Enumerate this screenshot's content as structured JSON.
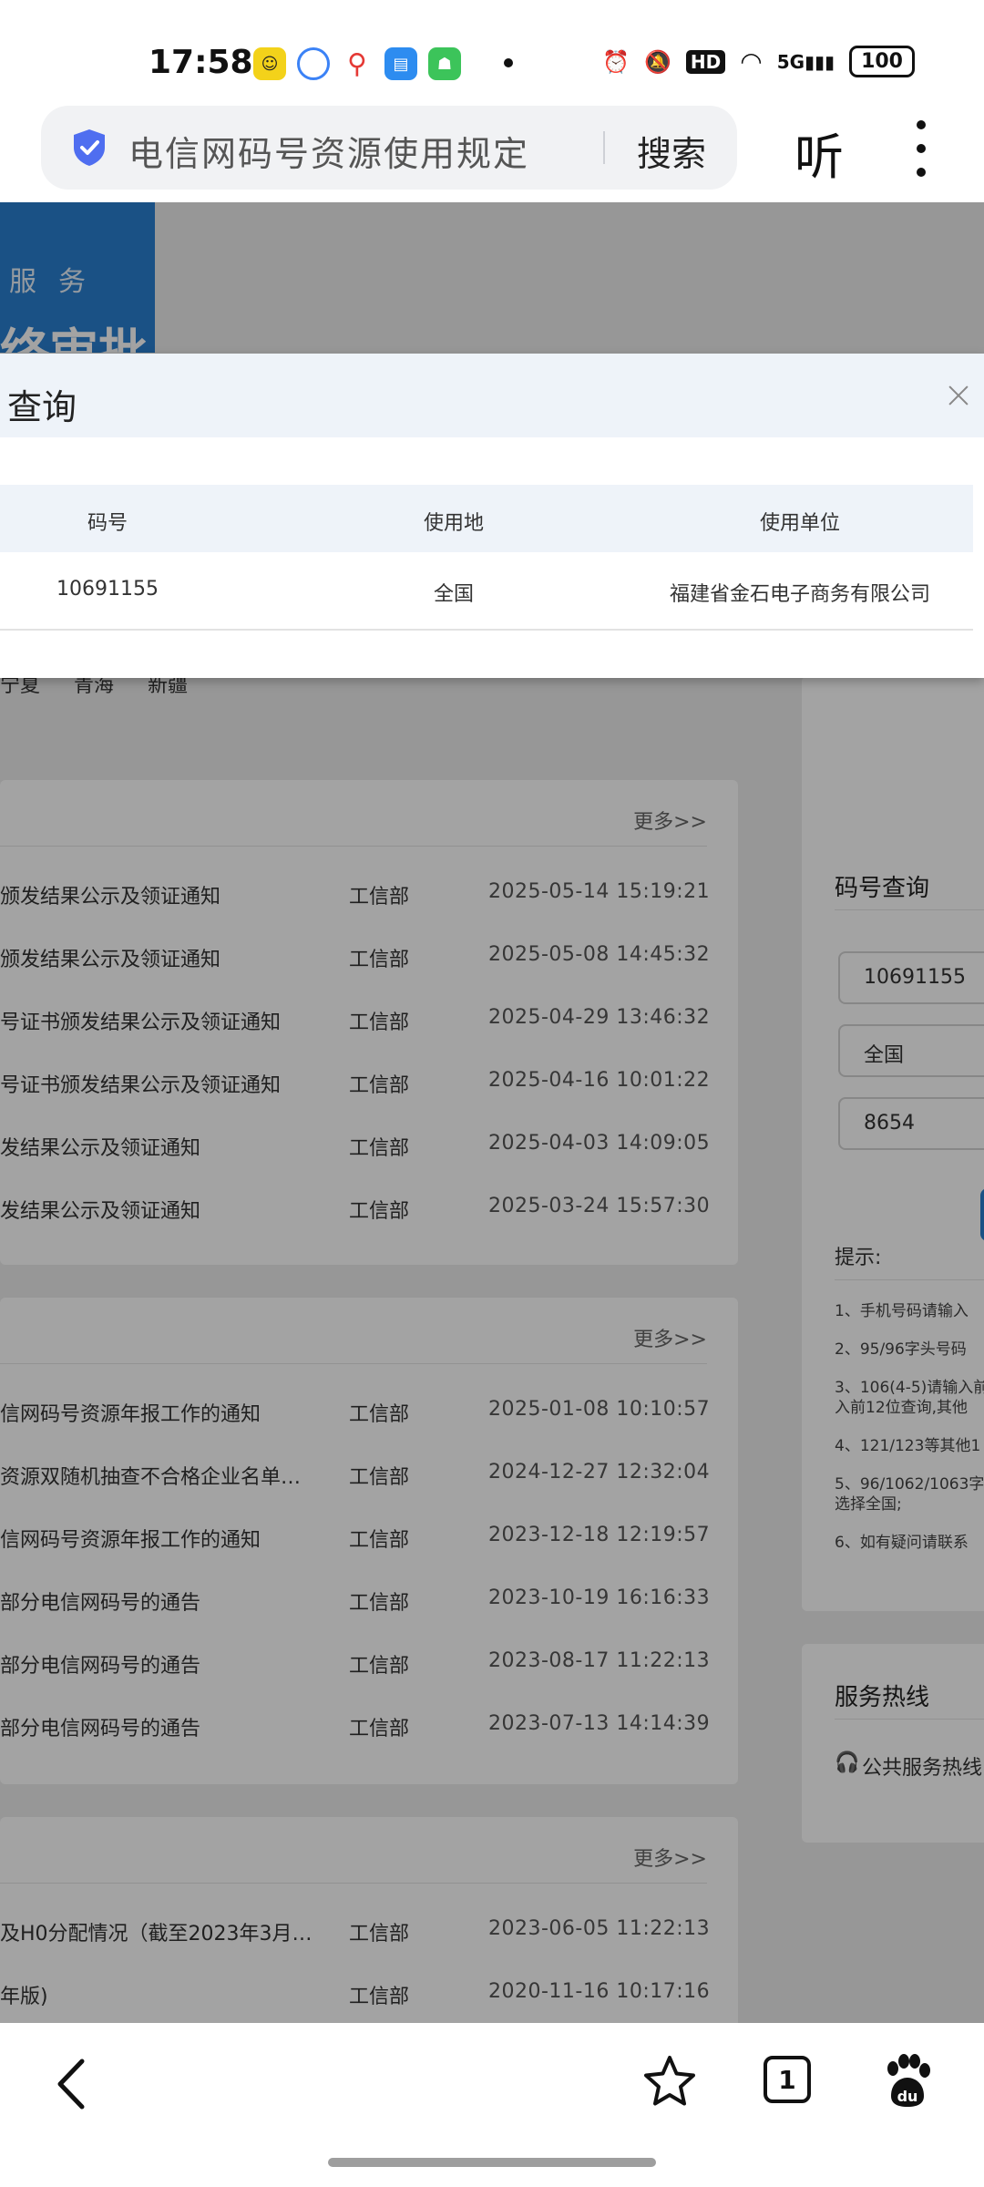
{
  "status_bar": {
    "time": "17:58",
    "hd_label": "HD",
    "network_label": "5G",
    "battery": "100"
  },
  "browser": {
    "address_text": "电信网码号资源使用规定",
    "search_label": "搜索",
    "listen_label": "听"
  },
  "banner": {
    "line1": "服务",
    "line2": "终审批"
  },
  "modal": {
    "title": "查询",
    "columns": [
      "码号",
      "使用地",
      "使用单位"
    ],
    "rows": [
      {
        "number": "10691155",
        "region": "全国",
        "unit": "福建省金石电子商务有限公司"
      }
    ]
  },
  "regions_strip": "宁夏 青海 新疆",
  "news_sections": [
    {
      "more_label": "更多>>",
      "items": [
        {
          "title": "颁发结果公示及领证通知",
          "org": "工信部",
          "date": "2025-05-14 15:19:21"
        },
        {
          "title": "颁发结果公示及领证通知",
          "org": "工信部",
          "date": "2025-05-08 14:45:32"
        },
        {
          "title": "号证书颁发结果公示及领证通知",
          "org": "工信部",
          "date": "2025-04-29 13:46:32"
        },
        {
          "title": "号证书颁发结果公示及领证通知",
          "org": "工信部",
          "date": "2025-04-16 10:01:22"
        },
        {
          "title": "发结果公示及领证通知",
          "org": "工信部",
          "date": "2025-04-03 14:09:05"
        },
        {
          "title": "发结果公示及领证通知",
          "org": "工信部",
          "date": "2025-03-24 15:57:30"
        }
      ]
    },
    {
      "more_label": "更多>>",
      "items": [
        {
          "title": "信网码号资源年报工作的通知",
          "org": "工信部",
          "date": "2025-01-08 10:10:57"
        },
        {
          "title": "资源双随机抽查不合格企业名单…",
          "org": "工信部",
          "date": "2024-12-27 12:32:04"
        },
        {
          "title": "信网码号资源年报工作的通知",
          "org": "工信部",
          "date": "2023-12-18 12:19:57"
        },
        {
          "title": "部分电信网码号的通告",
          "org": "工信部",
          "date": "2023-10-19 16:16:33"
        },
        {
          "title": "部分电信网码号的通告",
          "org": "工信部",
          "date": "2023-08-17 11:22:13"
        },
        {
          "title": "部分电信网码号的通告",
          "org": "工信部",
          "date": "2023-07-13 14:14:39"
        }
      ]
    },
    {
      "more_label": "更多>>",
      "items": [
        {
          "title": "及H0分配情况（截至2023年3月…",
          "org": "工信部",
          "date": "2023-06-05 11:22:13"
        },
        {
          "title": "年版)",
          "org": "工信部",
          "date": "2020-11-16 10:17:16"
        }
      ]
    }
  ],
  "query_panel": {
    "title": "码号查询",
    "number_value": "10691155",
    "region_value": "全国",
    "captcha_value": "8654",
    "tips_label": "提示:",
    "tips": [
      "1、手机号码请输入",
      "2、95/96字头号码",
      "3、106(4-5)请输入前",
      "入前12位查询,其他",
      "4、121/123等其他1",
      "5、96/1062/1063字",
      "选择全国;",
      "6、如有疑问请联系"
    ]
  },
  "hotline": {
    "title": "服务热线",
    "item": "公共服务热线"
  },
  "bottom_nav": {
    "tab_count": "1"
  }
}
